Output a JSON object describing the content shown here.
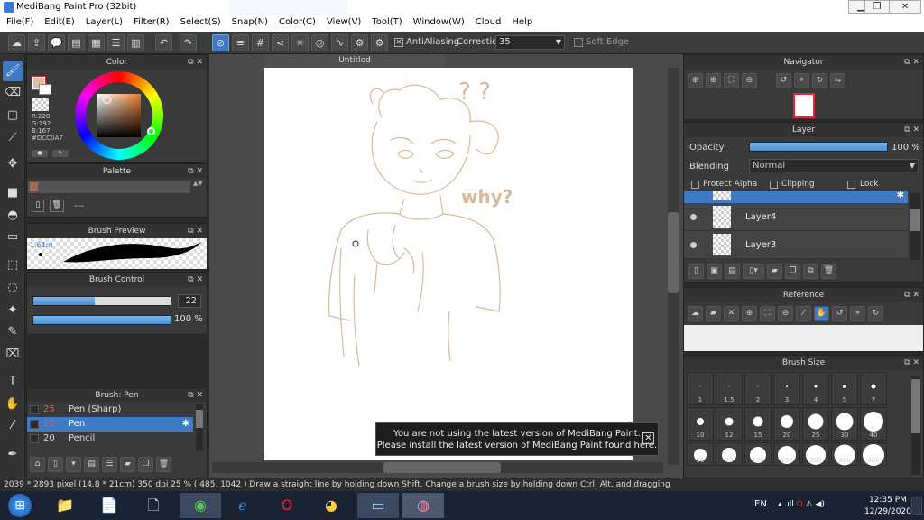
{
  "window": {
    "title": "MediBang Paint Pro (32bit)"
  },
  "menu": [
    "File(F)",
    "Edit(E)",
    "Layer(L)",
    "Filter(R)",
    "Select(S)",
    "Snap(N)",
    "Color(C)",
    "View(V)",
    "Tool(T)",
    "Window(W)",
    "Cloud",
    "Help"
  ],
  "toolbar": {
    "antialiasing_label": "AntiAliasing",
    "correction_label": "Correction",
    "correction_value": "35",
    "softedge_label": "Soft Edge"
  },
  "color_panel": {
    "title": "Color",
    "r": "R:220",
    "g": "G:192",
    "b": "B:167",
    "hex": "#DCC0A7"
  },
  "palette_panel": {
    "title": "Palette",
    "swatch_label": "---"
  },
  "brush_preview": {
    "title": "Brush Preview",
    "size": "1.61m"
  },
  "brush_control": {
    "title": "Brush Control",
    "size_value": "22",
    "size_fraction": 0.45,
    "opacity_value": "100 %",
    "opacity_fraction": 1.0
  },
  "brush_list": {
    "title": "Brush: Pen",
    "items": [
      {
        "size": "25",
        "name": "Pen (Sharp)"
      },
      {
        "size": "22",
        "name": "Pen"
      },
      {
        "size": "20",
        "name": "Pencil"
      }
    ]
  },
  "document": {
    "tab": "Untitled",
    "annotation_qq": "? ?",
    "annotation_why": "why?"
  },
  "notice": {
    "line1": "You are not using the latest version of MediBang Paint.",
    "line2": "Please install the latest version of MediBang Paint found here."
  },
  "navigator": {
    "title": "Navigator"
  },
  "layer_panel": {
    "title": "Layer",
    "opacity_label": "Opacity",
    "opacity_value": "100 %",
    "blending_label": "Blending",
    "blending_value": "Normal",
    "protect_alpha": "Protect Alpha",
    "clipping": "Clipping",
    "lock": "Lock",
    "layers": [
      "Layer4",
      "Layer3"
    ]
  },
  "reference": {
    "title": "Reference"
  },
  "brush_size": {
    "title": "Brush Size",
    "sizes": [
      "1",
      "1.5",
      "2",
      "3",
      "4",
      "5",
      "7",
      "10",
      "12",
      "15",
      "20",
      "25",
      "30",
      "40",
      "50",
      "70",
      "100",
      "150",
      "200",
      "300",
      "400"
    ]
  },
  "status": {
    "text": "2039 * 2893 pixel  (14.8 * 21cm)  350 dpi  25 %  ( 485, 1042 )  Draw a straight line by holding down Shift, Change a brush size by holding down Ctrl, Alt, and dragging"
  },
  "taskbar": {
    "lang": "EN",
    "time": "12:35 PM",
    "date": "12/29/2020"
  },
  "colors": {
    "accent": "#3e7bc4",
    "sketch": "#d9b89c",
    "current_color": "#DCC0A7"
  }
}
